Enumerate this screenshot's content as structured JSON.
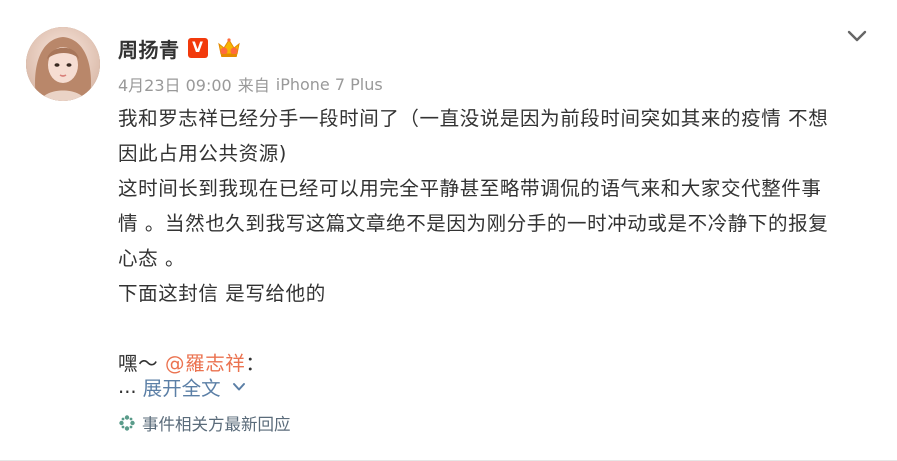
{
  "post": {
    "author": {
      "name": "周扬青",
      "verified_mark": "V"
    },
    "meta": {
      "date": "4月23日 09:00",
      "from_label": "来自",
      "source": "iPhone 7 Plus"
    },
    "body": {
      "line1": "我和罗志祥已经分手一段时间了（一直没说是因为前段时间突如其来的疫情 不想",
      "line2": "因此占用公共资源)",
      "line3": "这时间长到我现在已经可以用完全平静甚至略带调侃的语气来和大家交代整件事",
      "line4": "情 。当然也久到我写这篇文章绝不是因为刚分手的一时冲动或是不冷静下的报复",
      "line5": "心态 。",
      "line6": "下面这封信 是写给他的",
      "greeting_prefix": "嘿～ ",
      "mention": "@羅志祥",
      "greeting_suffix": "："
    },
    "expand": {
      "ellipsis": "...",
      "label": "展开全文"
    },
    "event_link": {
      "label": "事件相关方最新回应"
    }
  },
  "colors": {
    "link": "#5b7fa6",
    "verified": "#f23a0c",
    "meta_gray": "#999999"
  },
  "icons": {
    "verified": "verified-v-icon",
    "vip": "vip-crown-icon",
    "menu": "chevron-down-icon",
    "event": "asterisk-icon"
  }
}
